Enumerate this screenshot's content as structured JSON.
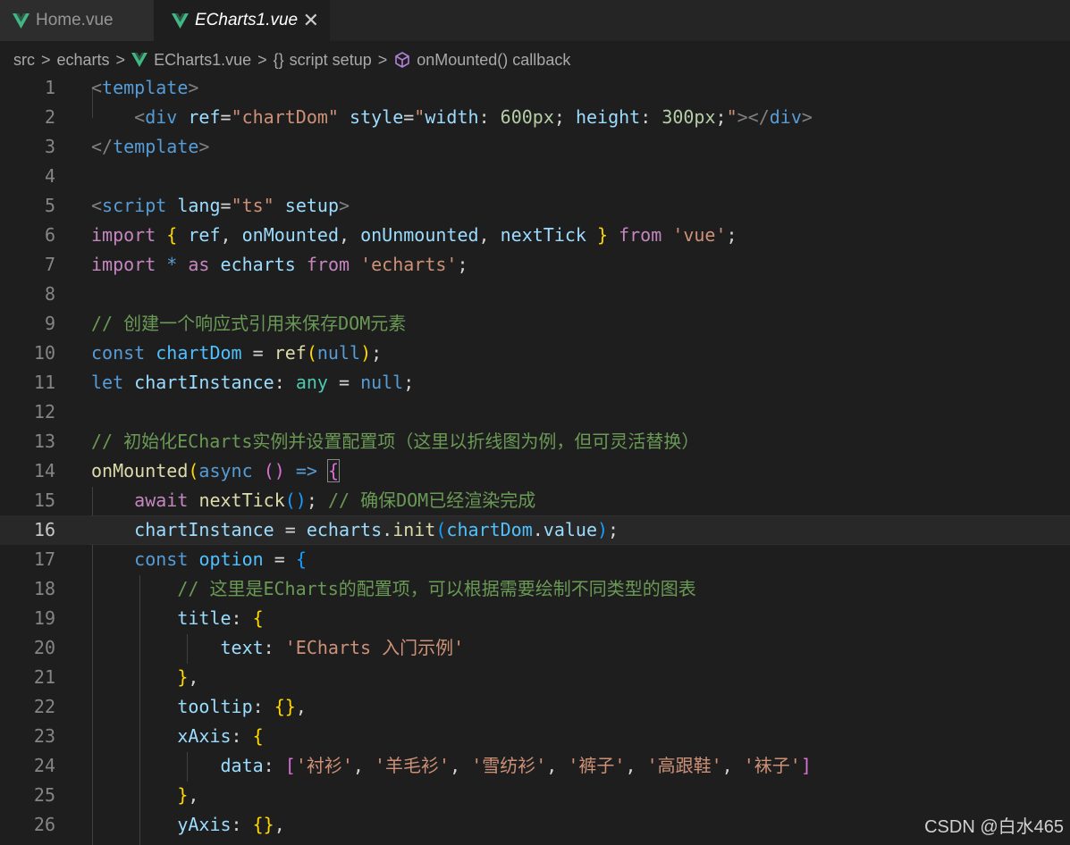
{
  "tabs": [
    {
      "label": "Home.vue",
      "icon": "vue-icon"
    },
    {
      "label": "ECharts1.vue",
      "icon": "vue-icon",
      "active": true,
      "close": "✕"
    }
  ],
  "breadcrumb": {
    "items": [
      "src",
      "echarts",
      "ECharts1.vue",
      "script setup",
      "onMounted() callback"
    ],
    "separator": ">",
    "braces": "{}"
  },
  "editor": {
    "active_line": 16,
    "lines": [
      {
        "n": "1",
        "tokens": [
          [
            "tagp",
            "<"
          ],
          [
            "kw",
            "template"
          ],
          [
            "tagp",
            ">"
          ]
        ]
      },
      {
        "n": "2",
        "tokens": [
          [
            "pun",
            "    "
          ],
          [
            "tagp",
            "<"
          ],
          [
            "kw",
            "div"
          ],
          [
            "pun",
            " "
          ],
          [
            "var",
            "ref"
          ],
          [
            "pun",
            "="
          ],
          [
            "str",
            "\"chartDom\""
          ],
          [
            "pun",
            " "
          ],
          [
            "var",
            "style"
          ],
          [
            "pun",
            "="
          ],
          [
            "str",
            "\""
          ],
          [
            "var",
            "width"
          ],
          [
            "pun",
            ": "
          ],
          [
            "num",
            "600px"
          ],
          [
            "pun",
            "; "
          ],
          [
            "var",
            "height"
          ],
          [
            "pun",
            ": "
          ],
          [
            "num",
            "300px"
          ],
          [
            "pun",
            ";"
          ],
          [
            "str",
            "\""
          ],
          [
            "tagp",
            "></"
          ],
          [
            "kw",
            "div"
          ],
          [
            "tagp",
            ">"
          ]
        ]
      },
      {
        "n": "3",
        "tokens": [
          [
            "tagp",
            "</"
          ],
          [
            "kw",
            "template"
          ],
          [
            "tagp",
            ">"
          ]
        ]
      },
      {
        "n": "4",
        "tokens": []
      },
      {
        "n": "5",
        "tokens": [
          [
            "tagp",
            "<"
          ],
          [
            "kw",
            "script"
          ],
          [
            "pun",
            " "
          ],
          [
            "var",
            "lang"
          ],
          [
            "pun",
            "="
          ],
          [
            "str",
            "\"ts\""
          ],
          [
            "pun",
            " "
          ],
          [
            "var",
            "setup"
          ],
          [
            "tagp",
            ">"
          ]
        ]
      },
      {
        "n": "6",
        "tokens": [
          [
            "ctl",
            "import"
          ],
          [
            "pun",
            " "
          ],
          [
            "b1",
            "{"
          ],
          [
            "pun",
            " "
          ],
          [
            "var",
            "ref"
          ],
          [
            "pun",
            ", "
          ],
          [
            "var",
            "onMounted"
          ],
          [
            "pun",
            ", "
          ],
          [
            "var",
            "onUnmounted"
          ],
          [
            "pun",
            ", "
          ],
          [
            "var",
            "nextTick"
          ],
          [
            "pun",
            " "
          ],
          [
            "b1",
            "}"
          ],
          [
            "pun",
            " "
          ],
          [
            "ctl",
            "from"
          ],
          [
            "pun",
            " "
          ],
          [
            "str",
            "'vue'"
          ],
          [
            "pun",
            ";"
          ]
        ]
      },
      {
        "n": "7",
        "tokens": [
          [
            "ctl",
            "import"
          ],
          [
            "pun",
            " "
          ],
          [
            "kw",
            "*"
          ],
          [
            "pun",
            " "
          ],
          [
            "ctl",
            "as"
          ],
          [
            "pun",
            " "
          ],
          [
            "var",
            "echarts"
          ],
          [
            "pun",
            " "
          ],
          [
            "ctl",
            "from"
          ],
          [
            "pun",
            " "
          ],
          [
            "str",
            "'echarts'"
          ],
          [
            "pun",
            ";"
          ]
        ]
      },
      {
        "n": "8",
        "tokens": []
      },
      {
        "n": "9",
        "tokens": [
          [
            "cmt",
            "// 创建一个响应式引用来保存DOM元素"
          ]
        ]
      },
      {
        "n": "10",
        "tokens": [
          [
            "kw",
            "const"
          ],
          [
            "pun",
            " "
          ],
          [
            "cst",
            "chartDom"
          ],
          [
            "pun",
            " = "
          ],
          [
            "fn",
            "ref"
          ],
          [
            "b1",
            "("
          ],
          [
            "kw",
            "null"
          ],
          [
            "b1",
            ")"
          ],
          [
            "pun",
            ";"
          ]
        ]
      },
      {
        "n": "11",
        "tokens": [
          [
            "kw",
            "let"
          ],
          [
            "pun",
            " "
          ],
          [
            "var",
            "chartInstance"
          ],
          [
            "pun",
            ": "
          ],
          [
            "typ",
            "any"
          ],
          [
            "pun",
            " = "
          ],
          [
            "kw",
            "null"
          ],
          [
            "pun",
            ";"
          ]
        ]
      },
      {
        "n": "12",
        "tokens": []
      },
      {
        "n": "13",
        "tokens": [
          [
            "cmt",
            "// 初始化ECharts实例并设置配置项（这里以折线图为例，但可灵活替换）"
          ]
        ]
      },
      {
        "n": "14",
        "tokens": [
          [
            "fn",
            "onMounted"
          ],
          [
            "b1",
            "("
          ],
          [
            "kw",
            "async"
          ],
          [
            "pun",
            " "
          ],
          [
            "b2",
            "()"
          ],
          [
            "pun",
            " "
          ],
          [
            "kw",
            "=>"
          ],
          [
            "pun",
            " "
          ],
          [
            "b2 bm",
            "{"
          ]
        ]
      },
      {
        "n": "15",
        "tokens": [
          [
            "pun",
            "    "
          ],
          [
            "ctl",
            "await"
          ],
          [
            "pun",
            " "
          ],
          [
            "fn",
            "nextTick"
          ],
          [
            "b3",
            "()"
          ],
          [
            "pun",
            "; "
          ],
          [
            "cmt",
            "// 确保DOM已经渲染完成"
          ]
        ]
      },
      {
        "n": "16",
        "tokens": [
          [
            "pun",
            "    "
          ],
          [
            "var",
            "chartInstance"
          ],
          [
            "pun",
            " = "
          ],
          [
            "var",
            "echarts"
          ],
          [
            "pun",
            "."
          ],
          [
            "fn",
            "init"
          ],
          [
            "b3",
            "("
          ],
          [
            "cst",
            "chartDom"
          ],
          [
            "pun",
            "."
          ],
          [
            "var",
            "value"
          ],
          [
            "b3",
            ")"
          ],
          [
            "pun",
            ";"
          ]
        ]
      },
      {
        "n": "17",
        "tokens": [
          [
            "pun",
            "    "
          ],
          [
            "kw",
            "const"
          ],
          [
            "pun",
            " "
          ],
          [
            "cst",
            "option"
          ],
          [
            "pun",
            " = "
          ],
          [
            "b3",
            "{"
          ]
        ]
      },
      {
        "n": "18",
        "tokens": [
          [
            "pun",
            "        "
          ],
          [
            "cmt",
            "// 这里是ECharts的配置项，可以根据需要绘制不同类型的图表"
          ]
        ]
      },
      {
        "n": "19",
        "tokens": [
          [
            "pun",
            "        "
          ],
          [
            "var",
            "title"
          ],
          [
            "pun",
            ": "
          ],
          [
            "b1",
            "{"
          ]
        ]
      },
      {
        "n": "20",
        "tokens": [
          [
            "pun",
            "            "
          ],
          [
            "var",
            "text"
          ],
          [
            "pun",
            ": "
          ],
          [
            "str",
            "'ECharts 入门示例'"
          ]
        ]
      },
      {
        "n": "21",
        "tokens": [
          [
            "pun",
            "        "
          ],
          [
            "b1",
            "}"
          ],
          [
            "pun",
            ","
          ]
        ]
      },
      {
        "n": "22",
        "tokens": [
          [
            "pun",
            "        "
          ],
          [
            "var",
            "tooltip"
          ],
          [
            "pun",
            ": "
          ],
          [
            "b1",
            "{}"
          ],
          [
            "pun",
            ","
          ]
        ]
      },
      {
        "n": "23",
        "tokens": [
          [
            "pun",
            "        "
          ],
          [
            "var",
            "xAxis"
          ],
          [
            "pun",
            ": "
          ],
          [
            "b1",
            "{"
          ]
        ]
      },
      {
        "n": "24",
        "tokens": [
          [
            "pun",
            "            "
          ],
          [
            "var",
            "data"
          ],
          [
            "pun",
            ": "
          ],
          [
            "b2",
            "["
          ],
          [
            "str",
            "'衬衫'"
          ],
          [
            "pun",
            ", "
          ],
          [
            "str",
            "'羊毛衫'"
          ],
          [
            "pun",
            ", "
          ],
          [
            "str",
            "'雪纺衫'"
          ],
          [
            "pun",
            ", "
          ],
          [
            "str",
            "'裤子'"
          ],
          [
            "pun",
            ", "
          ],
          [
            "str",
            "'高跟鞋'"
          ],
          [
            "pun",
            ", "
          ],
          [
            "str",
            "'袜子'"
          ],
          [
            "b2",
            "]"
          ]
        ]
      },
      {
        "n": "25",
        "tokens": [
          [
            "pun",
            "        "
          ],
          [
            "b1",
            "}"
          ],
          [
            "pun",
            ","
          ]
        ]
      },
      {
        "n": "26",
        "tokens": [
          [
            "pun",
            "        "
          ],
          [
            "var",
            "yAxis"
          ],
          [
            "pun",
            ": "
          ],
          [
            "b1",
            "{}"
          ],
          [
            "pun",
            ","
          ]
        ]
      }
    ]
  },
  "watermark": "CSDN @白水465"
}
